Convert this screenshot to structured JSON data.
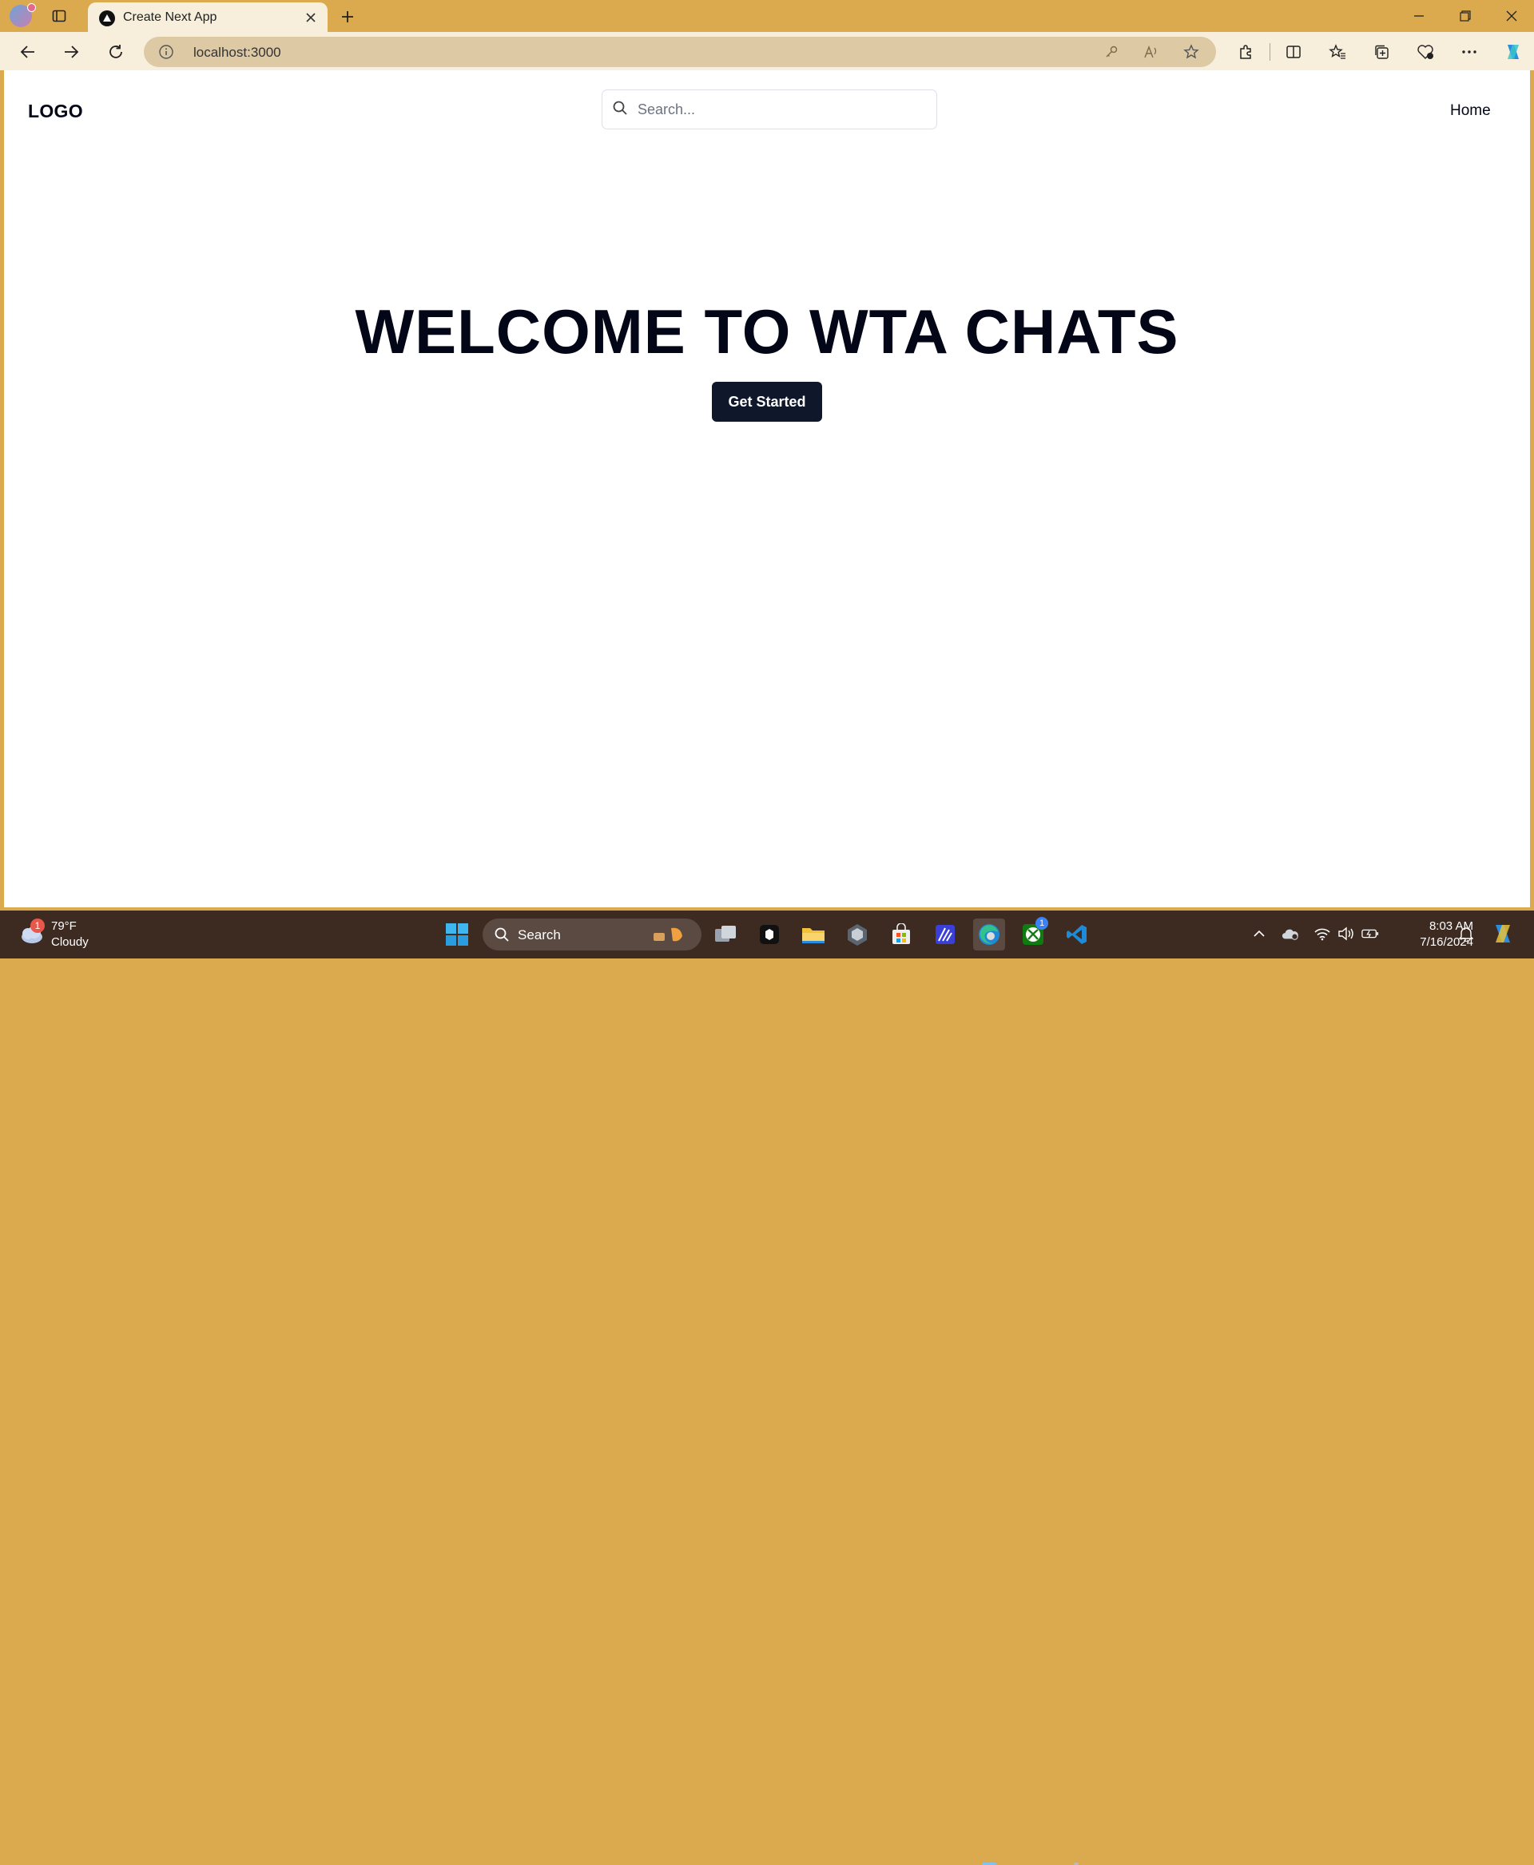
{
  "browser": {
    "tab_title": "Create Next App",
    "address": "localhost:3000"
  },
  "page": {
    "logo": "LOGO",
    "search_placeholder": "Search...",
    "nav_home": "Home",
    "hero_title": "WELCOME TO WTA CHATS",
    "cta_label": "Get Started"
  },
  "taskbar": {
    "weather_temp": "79°F",
    "weather_condition": "Cloudy",
    "weather_badge": "1",
    "search_label": "Search",
    "xbox_badge": "1",
    "time": "8:03 AM",
    "date": "7/16/2024"
  },
  "colors": {
    "titlebar": "#dcaa4e",
    "toolbar": "#f7eedb",
    "page_text": "#020617",
    "button_bg": "#0f172a",
    "taskbar": "#3d2b22"
  }
}
